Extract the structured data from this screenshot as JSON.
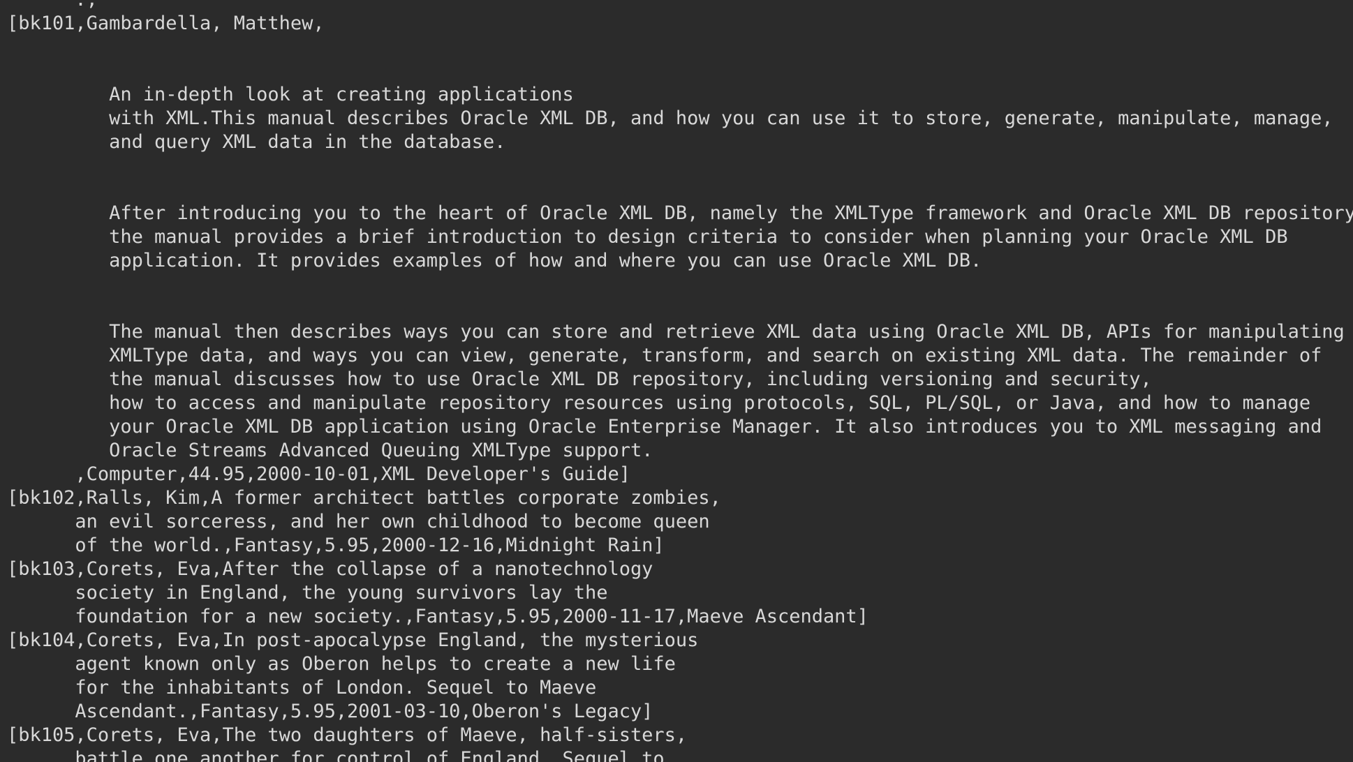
{
  "terminal": {
    "background": "#2b2b2b",
    "foreground": "#d8d8d8",
    "lines": [
      "      .,                                                                                         ",
      "[bk101,Gambardella, Matthew,",
      "",
      "",
      "         An in-depth look at creating applications",
      "         with XML.This manual describes Oracle XML DB, and how you can use it to store, generate, manipulate, manage,",
      "         and query XML data in the database.",
      "",
      "",
      "         After introducing you to the heart of Oracle XML DB, namely the XMLType framework and Oracle XML DB repository,",
      "         the manual provides a brief introduction to design criteria to consider when planning your Oracle XML DB",
      "         application. It provides examples of how and where you can use Oracle XML DB.",
      "",
      "",
      "         The manual then describes ways you can store and retrieve XML data using Oracle XML DB, APIs for manipulating",
      "         XMLType data, and ways you can view, generate, transform, and search on existing XML data. The remainder of",
      "         the manual discusses how to use Oracle XML DB repository, including versioning and security,",
      "         how to access and manipulate repository resources using protocols, SQL, PL/SQL, or Java, and how to manage",
      "         your Oracle XML DB application using Oracle Enterprise Manager. It also introduces you to XML messaging and",
      "         Oracle Streams Advanced Queuing XMLType support.",
      "      ,Computer,44.95,2000-10-01,XML Developer's Guide]",
      "[bk102,Ralls, Kim,A former architect battles corporate zombies,",
      "      an evil sorceress, and her own childhood to become queen",
      "      of the world.,Fantasy,5.95,2000-12-16,Midnight Rain]",
      "[bk103,Corets, Eva,After the collapse of a nanotechnology",
      "      society in England, the young survivors lay the",
      "      foundation for a new society.,Fantasy,5.95,2000-11-17,Maeve Ascendant]",
      "[bk104,Corets, Eva,In post-apocalypse England, the mysterious",
      "      agent known only as Oberon helps to create a new life",
      "      for the inhabitants of London. Sequel to Maeve",
      "      Ascendant.,Fantasy,5.95,2001-03-10,Oberon's Legacy]",
      "[bk105,Corets, Eva,The two daughters of Maeve, half-sisters,",
      "      battle one another for control of England. Sequel to"
    ]
  }
}
